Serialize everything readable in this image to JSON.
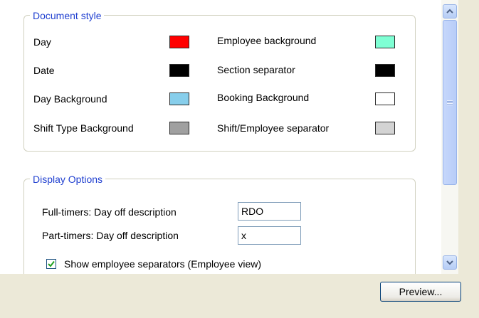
{
  "document_style": {
    "legend": "Document style",
    "items": [
      {
        "label": "Day",
        "color": "#ff0000"
      },
      {
        "label": "Date",
        "color": "#000000"
      },
      {
        "label": "Day Background",
        "color": "#87ceeb"
      },
      {
        "label": "Shift Type Background",
        "color": "#a0a0a0"
      },
      {
        "label": "Employee background",
        "color": "#7fffd4"
      },
      {
        "label": "Section separator",
        "color": "#000000"
      },
      {
        "label": "Booking Background",
        "color": "#ffffff"
      },
      {
        "label": "Shift/Employee separator",
        "color": "#d3d3d3"
      }
    ]
  },
  "display_options": {
    "legend": "Display Options",
    "full_timers_label": "Full-timers: Day off description",
    "full_timers_value": "RDO",
    "part_timers_label": "Part-timers: Day off description",
    "part_timers_value": "x",
    "show_separators_label": "Show employee separators (Employee view)",
    "show_separators_checked": true
  },
  "preview_button": "Preview...",
  "icons": [
    "scroll-up-arrow-icon",
    "scroll-down-arrow-icon",
    "grip-icon",
    "checkmark-icon"
  ]
}
